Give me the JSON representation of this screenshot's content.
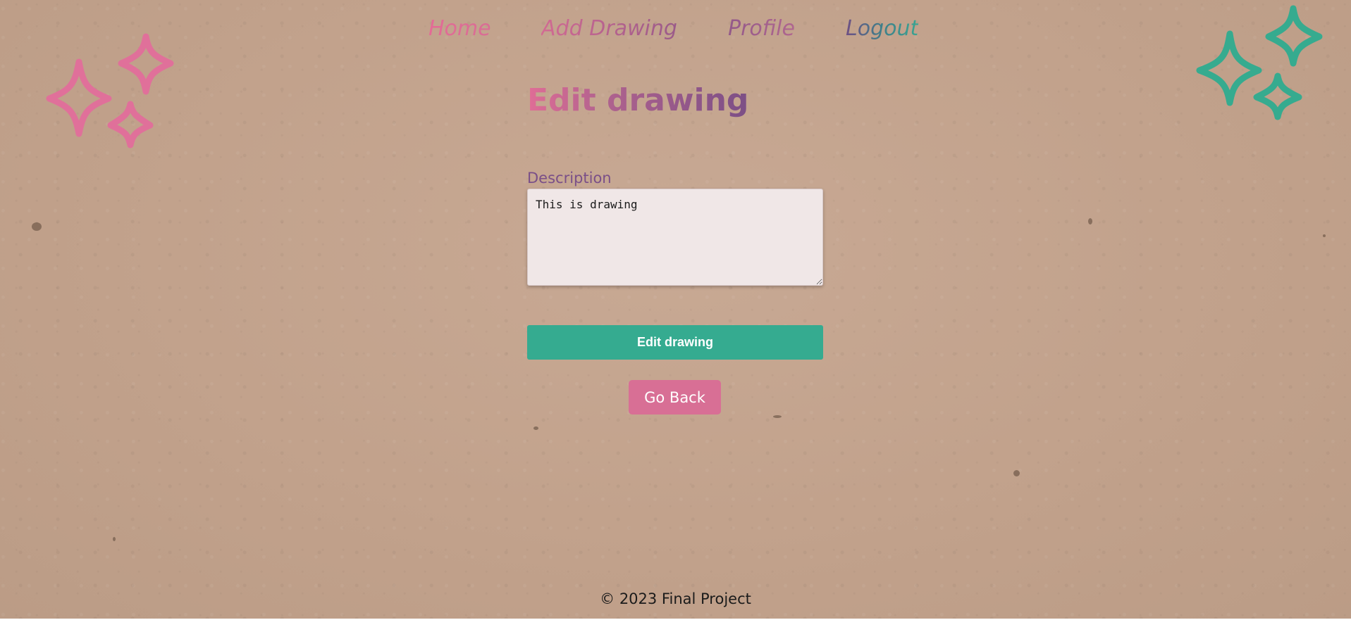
{
  "nav": {
    "home": "Home",
    "add_drawing": "Add Drawing",
    "profile": "Profile",
    "logout": "Logout"
  },
  "decor": {
    "left": "sparkles-icon",
    "right": "sparkles-icon",
    "left_color": "#e0709a",
    "right_color": "#36ab8f"
  },
  "form": {
    "title": "Edit drawing",
    "description_label": "Description",
    "description_value": "This is drawing",
    "submit_label": "Edit drawing",
    "back_label": "Go Back"
  },
  "footer": {
    "text": "© 2023 Final Project"
  },
  "colors": {
    "background": "#c4a58f",
    "primary": "#35ab90",
    "secondary": "#d86f95",
    "label": "#7a4f88",
    "input_bg": "#f0e7e7"
  }
}
